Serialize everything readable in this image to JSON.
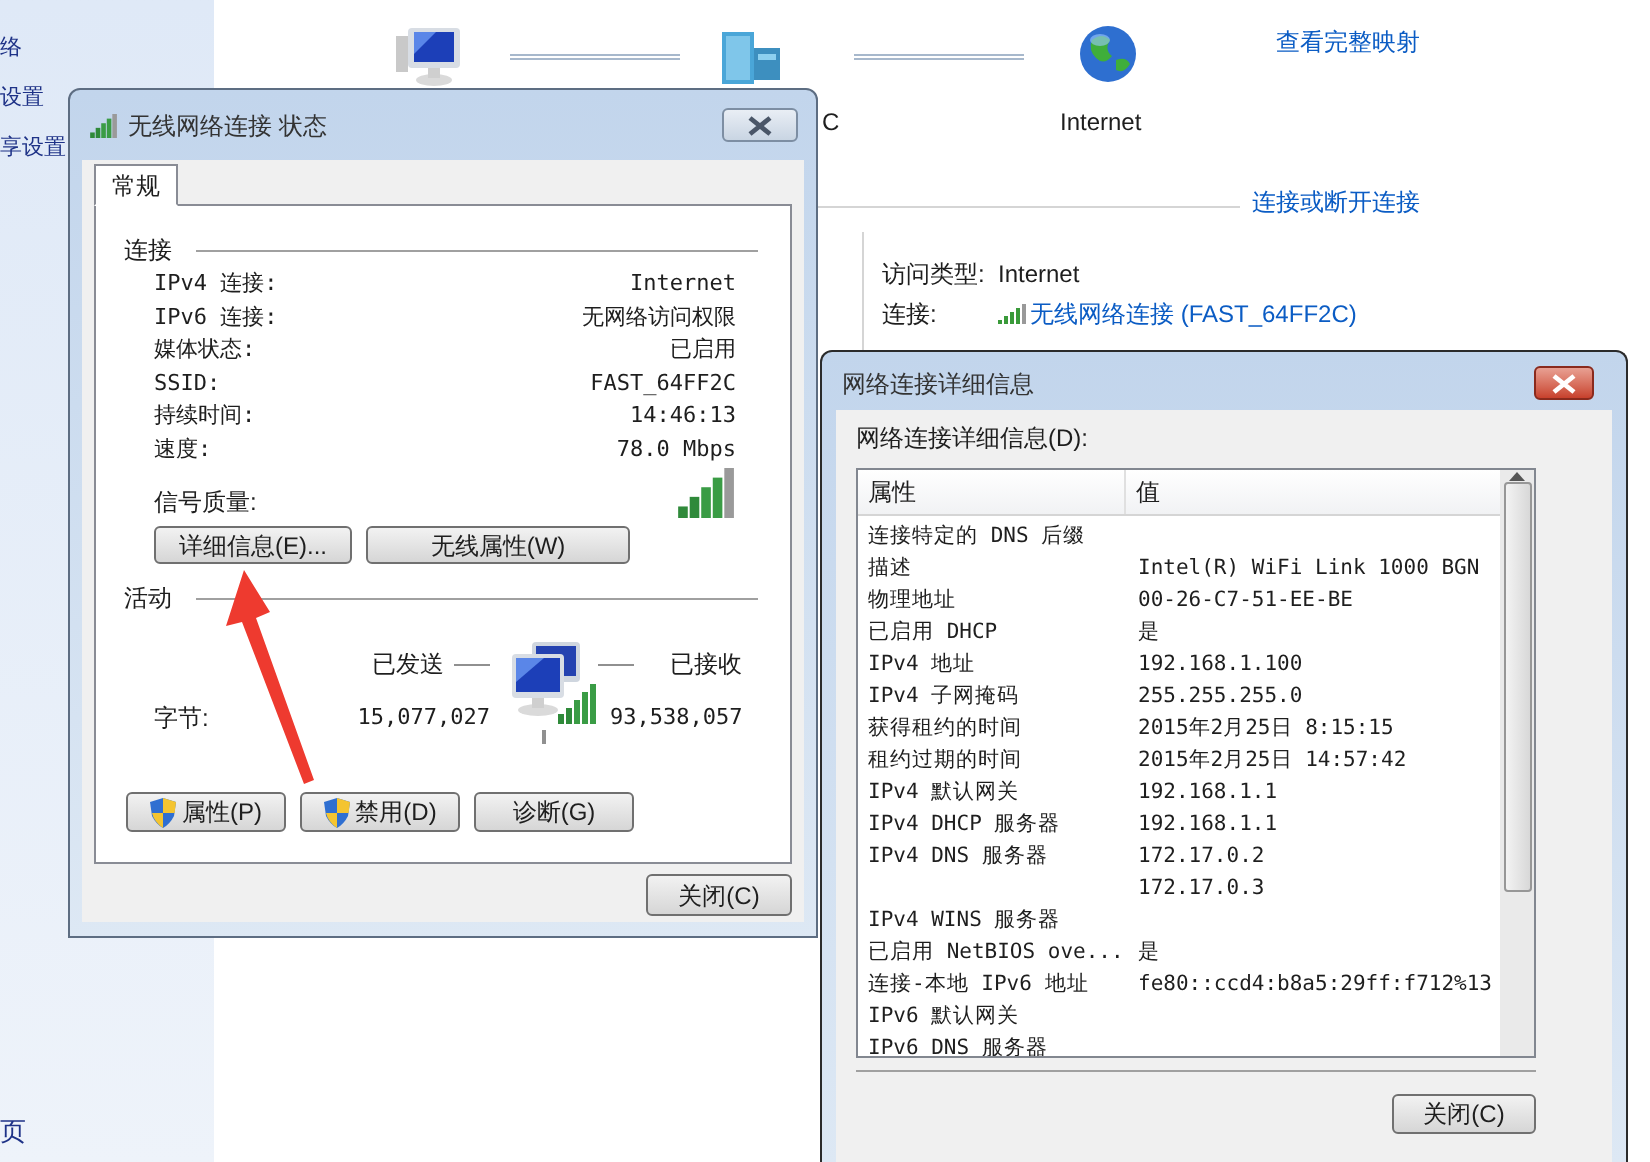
{
  "sidebar": {
    "items": [
      "络",
      "设置",
      "享设置"
    ],
    "footer": "页"
  },
  "network_map": {
    "nodes": [
      {
        "kind": "computer"
      },
      {
        "kind": "server",
        "label": "C"
      },
      {
        "kind": "globe",
        "label": "Internet"
      }
    ],
    "link": "查看完整映射"
  },
  "active_networks": {
    "link": "连接或断开连接",
    "fields": [
      {
        "label": "访问类型:",
        "value": "Internet",
        "kind": "text"
      },
      {
        "label": "连接:",
        "value": "无线网络连接 (FAST_64FF2C)",
        "kind": "link"
      }
    ]
  },
  "status_dialog": {
    "title": "无线网络连接 状态",
    "tabs": [
      {
        "label": "常规",
        "selected": true
      }
    ],
    "connection": {
      "heading": "连接",
      "rows": [
        {
          "label": "IPv4 连接:",
          "value": "Internet"
        },
        {
          "label": "IPv6 连接:",
          "value": "无网络访问权限"
        },
        {
          "label": "媒体状态:",
          "value": "已启用"
        },
        {
          "label": "SSID:",
          "value": "FAST_64FF2C"
        },
        {
          "label": "持续时间:",
          "value": "14:46:13"
        },
        {
          "label": "速度:",
          "value": "78.0 Mbps"
        }
      ],
      "signal_label": "信号质量:"
    },
    "buttons": [
      "详细信息(E)...",
      "无线属性(W)"
    ],
    "activity": {
      "heading": "活动",
      "sent_label": "已发送",
      "received_label": "已接收",
      "bytes_label": "字节:",
      "sent": "15,077,027",
      "received": "93,538,057"
    },
    "action_buttons": [
      {
        "label": "属性(P)",
        "shield": true
      },
      {
        "label": "禁用(D)",
        "shield": true
      },
      {
        "label": "诊断(G)",
        "shield": false
      }
    ],
    "close_button": "关闭(C)"
  },
  "details_dialog": {
    "title": "网络连接详细信息",
    "list_label": "网络连接详细信息(D):",
    "columns": [
      "属性",
      "值"
    ],
    "rows": [
      {
        "property": "连接特定的 DNS 后缀"
      },
      {
        "property": "描述",
        "value": "Intel(R) WiFi Link 1000 BGN"
      },
      {
        "property": "物理地址",
        "value": "00-26-C7-51-EE-BE"
      },
      {
        "property": "已启用 DHCP",
        "value": "是"
      },
      {
        "property": "IPv4 地址",
        "value": "192.168.1.100"
      },
      {
        "property": "IPv4 子网掩码",
        "value": "255.255.255.0"
      },
      {
        "property": "获得租约的时间",
        "value": "2015年2月25日 8:15:15"
      },
      {
        "property": "租约过期的时间",
        "value": "2015年2月25日 14:57:42"
      },
      {
        "property": "IPv4 默认网关",
        "value": "192.168.1.1"
      },
      {
        "property": "IPv4 DHCP 服务器",
        "value": "192.168.1.1"
      },
      {
        "property": "IPv4 DNS 服务器",
        "value": "172.17.0.2"
      },
      {
        "value": "172.17.0.3"
      },
      {
        "property": "IPv4 WINS 服务器"
      },
      {
        "property": "已启用 NetBIOS ove...",
        "value": "是"
      },
      {
        "property": "连接-本地 IPv6 地址",
        "value": "fe80::ccd4:b8a5:29ff:f712%13"
      },
      {
        "property": "IPv6 默认网关"
      },
      {
        "property": "IPv6 DNS 服务器"
      }
    ],
    "close_button": "关闭(C)"
  }
}
